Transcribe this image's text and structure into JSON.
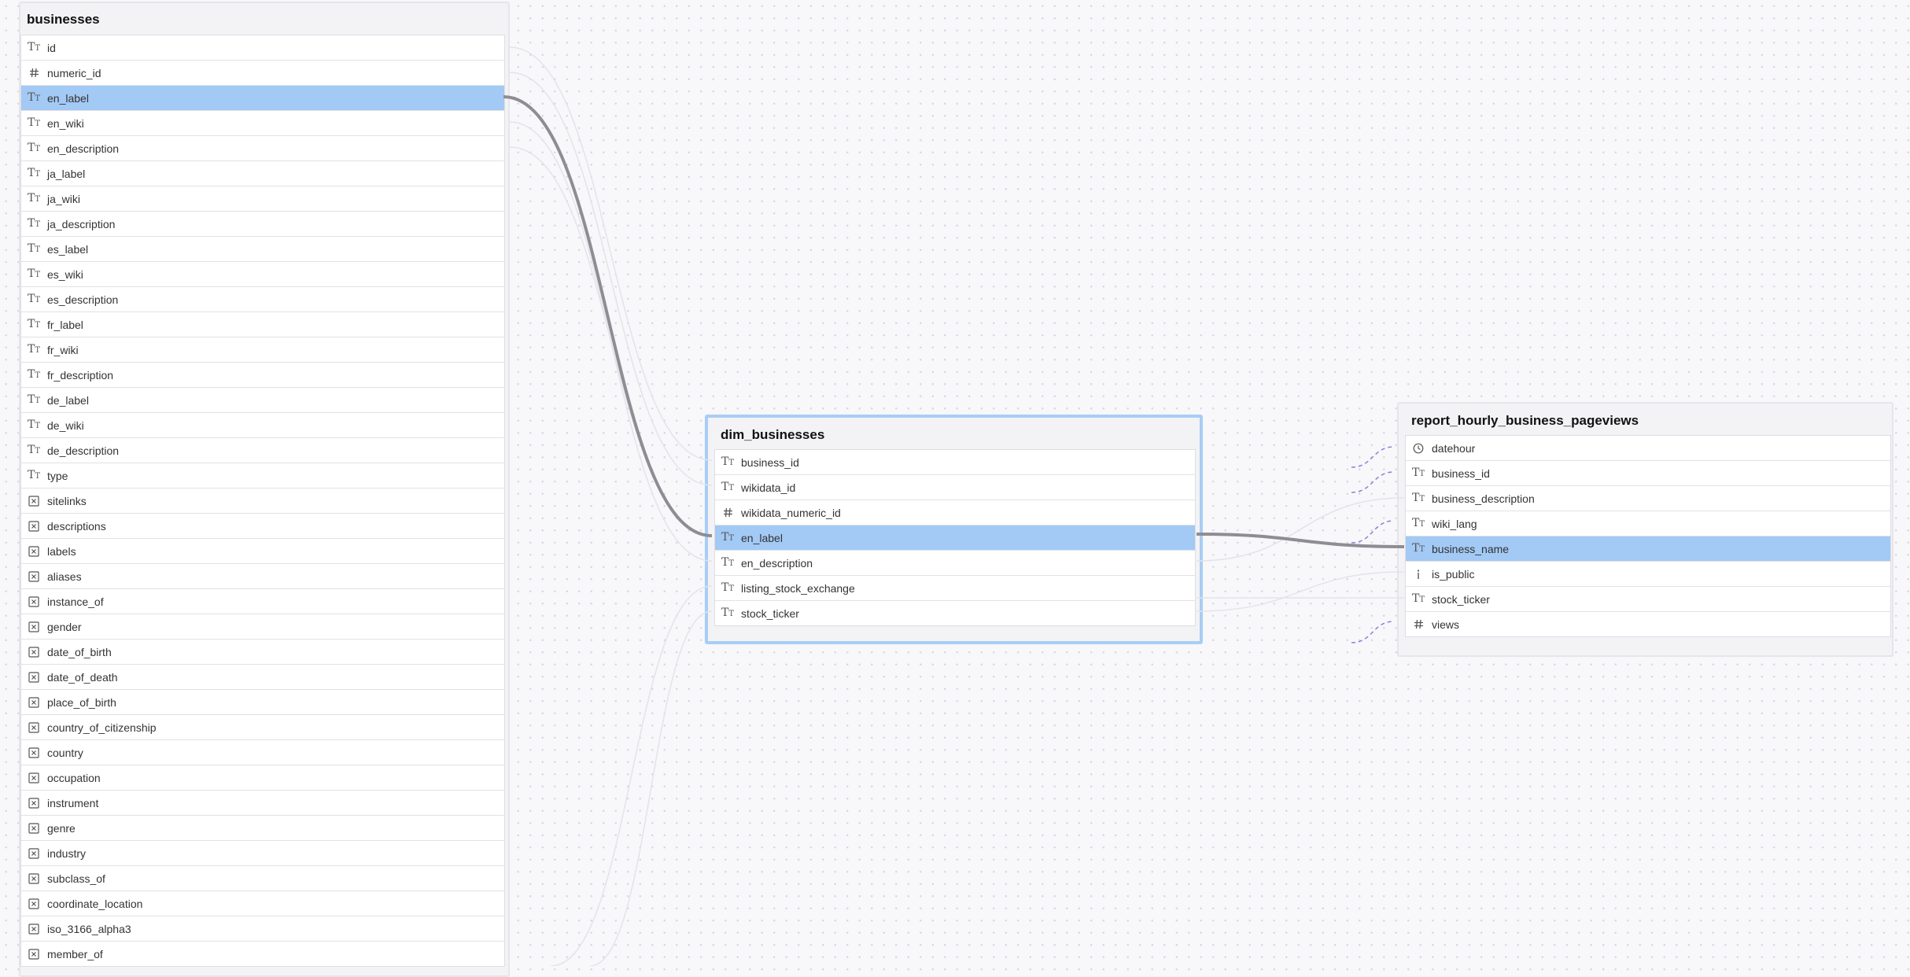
{
  "tables": {
    "businesses": {
      "title": "businesses",
      "columns": [
        {
          "name": "id",
          "icon": "text-type-icon"
        },
        {
          "name": "numeric_id",
          "icon": "hash-icon"
        },
        {
          "name": "en_label",
          "icon": "text-type-icon",
          "highlighted": true
        },
        {
          "name": "en_wiki",
          "icon": "text-type-icon"
        },
        {
          "name": "en_description",
          "icon": "text-type-icon"
        },
        {
          "name": "ja_label",
          "icon": "text-type-icon"
        },
        {
          "name": "ja_wiki",
          "icon": "text-type-icon"
        },
        {
          "name": "ja_description",
          "icon": "text-type-icon"
        },
        {
          "name": "es_label",
          "icon": "text-type-icon"
        },
        {
          "name": "es_wiki",
          "icon": "text-type-icon"
        },
        {
          "name": "es_description",
          "icon": "text-type-icon"
        },
        {
          "name": "fr_label",
          "icon": "text-type-icon"
        },
        {
          "name": "fr_wiki",
          "icon": "text-type-icon"
        },
        {
          "name": "fr_description",
          "icon": "text-type-icon"
        },
        {
          "name": "de_label",
          "icon": "text-type-icon"
        },
        {
          "name": "de_wiki",
          "icon": "text-type-icon"
        },
        {
          "name": "de_description",
          "icon": "text-type-icon"
        },
        {
          "name": "type",
          "icon": "text-type-icon"
        },
        {
          "name": "sitelinks",
          "icon": "array-icon"
        },
        {
          "name": "descriptions",
          "icon": "array-icon"
        },
        {
          "name": "labels",
          "icon": "array-icon"
        },
        {
          "name": "aliases",
          "icon": "array-icon"
        },
        {
          "name": "instance_of",
          "icon": "array-icon"
        },
        {
          "name": "gender",
          "icon": "array-icon"
        },
        {
          "name": "date_of_birth",
          "icon": "array-icon"
        },
        {
          "name": "date_of_death",
          "icon": "array-icon"
        },
        {
          "name": "place_of_birth",
          "icon": "array-icon"
        },
        {
          "name": "country_of_citizenship",
          "icon": "array-icon"
        },
        {
          "name": "country",
          "icon": "array-icon"
        },
        {
          "name": "occupation",
          "icon": "array-icon"
        },
        {
          "name": "instrument",
          "icon": "array-icon"
        },
        {
          "name": "genre",
          "icon": "array-icon"
        },
        {
          "name": "industry",
          "icon": "array-icon"
        },
        {
          "name": "subclass_of",
          "icon": "array-icon"
        },
        {
          "name": "coordinate_location",
          "icon": "array-icon"
        },
        {
          "name": "iso_3166_alpha3",
          "icon": "array-icon"
        },
        {
          "name": "member_of",
          "icon": "array-icon"
        }
      ]
    },
    "dim_businesses": {
      "title": "dim_businesses",
      "selected": true,
      "columns": [
        {
          "name": "business_id",
          "icon": "text-type-icon"
        },
        {
          "name": "wikidata_id",
          "icon": "text-type-icon"
        },
        {
          "name": "wikidata_numeric_id",
          "icon": "hash-icon"
        },
        {
          "name": "en_label",
          "icon": "text-type-icon",
          "highlighted": true
        },
        {
          "name": "en_description",
          "icon": "text-type-icon"
        },
        {
          "name": "listing_stock_exchange",
          "icon": "text-type-icon"
        },
        {
          "name": "stock_ticker",
          "icon": "text-type-icon"
        }
      ]
    },
    "report_hourly_business_pageviews": {
      "title": "report_hourly_business_pageviews",
      "columns": [
        {
          "name": "datehour",
          "icon": "clock-icon"
        },
        {
          "name": "business_id",
          "icon": "text-type-icon"
        },
        {
          "name": "business_description",
          "icon": "text-type-icon"
        },
        {
          "name": "wiki_lang",
          "icon": "text-type-icon"
        },
        {
          "name": "business_name",
          "icon": "text-type-icon",
          "highlighted": true
        },
        {
          "name": "is_public",
          "icon": "boolean-icon"
        },
        {
          "name": "stock_ticker",
          "icon": "text-type-icon"
        },
        {
          "name": "views",
          "icon": "hash-icon"
        }
      ]
    }
  },
  "colors": {
    "highlight_row": "#a3c9f5",
    "selected_border": "#a8cdf6",
    "lineage_strong": "#8e8d93",
    "lineage_faint": "#e4e3e8",
    "lineage_dashed": "#8f7fd6"
  }
}
